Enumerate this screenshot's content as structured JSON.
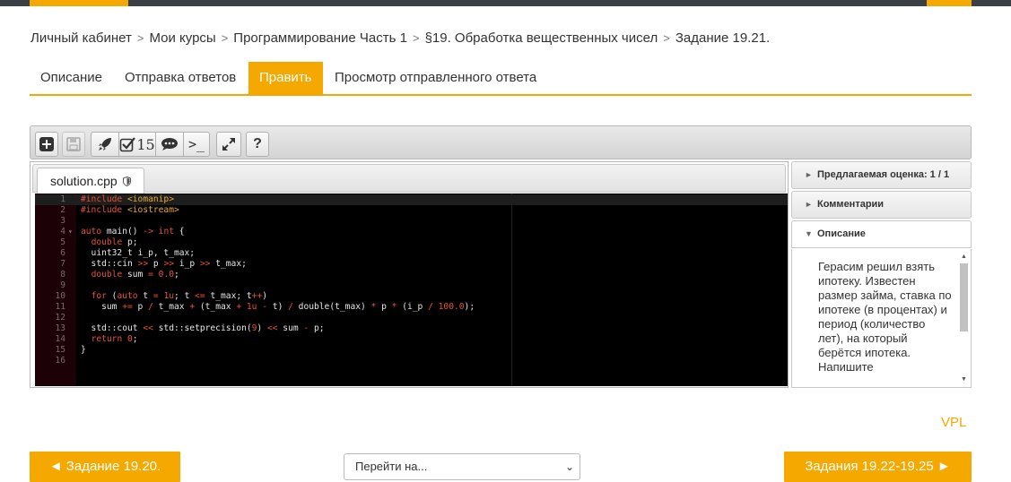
{
  "breadcrumb": [
    "Личный кабинет",
    "Мои курсы",
    "Программирование Часть 1",
    "§19. Обработка вещественных чисел",
    "Задание 19.21."
  ],
  "tabs": [
    {
      "label": "Описание",
      "active": false
    },
    {
      "label": "Отправка ответов",
      "active": false
    },
    {
      "label": "Править",
      "active": true
    },
    {
      "label": "Просмотр отправленного ответа",
      "active": false
    }
  ],
  "toolbar": {
    "buttons": [
      "add-file-icon",
      "save-icon",
      "run-icon",
      "evaluate-icon",
      "comments-icon",
      "console-icon",
      "fullscreen-icon",
      "help-icon"
    ],
    "evaluate_count": "15",
    "console_label": ">_",
    "help_label": "?"
  },
  "editor": {
    "filename": "solution.cpp",
    "lines": [
      {
        "n": "1",
        "html": "<span class='k-pre'>#include</span> <span class='k-inc'>&lt;iomanip&gt;</span>"
      },
      {
        "n": "2",
        "html": "<span class='k-pre'>#include</span> <span class='k-inc'>&lt;iostream&gt;</span>"
      },
      {
        "n": "3",
        "html": ""
      },
      {
        "n": "4",
        "fold": true,
        "html": "<span class='k-kw'>auto</span> main() <span class='k-op'>-&gt;</span> <span class='k-kw'>int</span> {"
      },
      {
        "n": "5",
        "html": "  <span class='k-kw'>double</span> p;"
      },
      {
        "n": "6",
        "html": "  uint32_t i_p, t_max;"
      },
      {
        "n": "7",
        "html": "  std::cin <span class='k-op'>&gt;&gt;</span> p <span class='k-op'>&gt;&gt;</span> i_p <span class='k-op'>&gt;&gt;</span> t_max;"
      },
      {
        "n": "8",
        "html": "  <span class='k-kw'>double</span> sum <span class='k-op'>=</span> <span class='k-num'>0.0</span>;"
      },
      {
        "n": "9",
        "html": ""
      },
      {
        "n": "10",
        "html": "  <span class='k-kw'>for</span> (<span class='k-kw'>auto</span> t <span class='k-op'>=</span> <span class='k-num'>1u</span>; t <span class='k-op'>&lt;=</span> t_max; t<span class='k-op'>++</span>)"
      },
      {
        "n": "11",
        "html": "    sum <span class='k-op'>+=</span> p <span class='k-op'>/</span> t_max <span class='k-op'>+</span> (t_max <span class='k-op'>+</span> <span class='k-num'>1u</span> <span class='k-op'>-</span> t) <span class='k-op'>/</span> double(t_max) <span class='k-op'>*</span> p <span class='k-op'>*</span> (i_p <span class='k-op'>/</span> <span class='k-num'>100.0</span>);"
      },
      {
        "n": "12",
        "html": ""
      },
      {
        "n": "13",
        "html": "  std::cout <span class='k-op'>&lt;&lt;</span> std::setprecision(<span class='k-num'>9</span>) <span class='k-op'>&lt;&lt;</span> sum <span class='k-op'>-</span> p;"
      },
      {
        "n": "14",
        "html": "  <span class='k-kw'>return</span> <span class='k-num'>0</span>;"
      },
      {
        "n": "15",
        "html": "}"
      },
      {
        "n": "16",
        "html": ""
      }
    ]
  },
  "side": {
    "grade_label": "Предлагаемая оценка: 1 / 1",
    "comments_label": "Комментарии",
    "description_label": "Описание",
    "description_text": "Герасим решил взять ипотеку. Известен размер займа, ставка по ипотеке (в процентах) и период (количество лет), на который берётся ипотека. Напишите"
  },
  "vpl_label": "VPL",
  "nav": {
    "prev_label": "◄ Задание 19.20.",
    "jump_label": "Перейти на...",
    "next_label": "Задания 19.22-19.25 ►"
  },
  "colors": {
    "accent": "#f5a800",
    "topbar": "#3a4046",
    "editor_bg": "#000000"
  }
}
